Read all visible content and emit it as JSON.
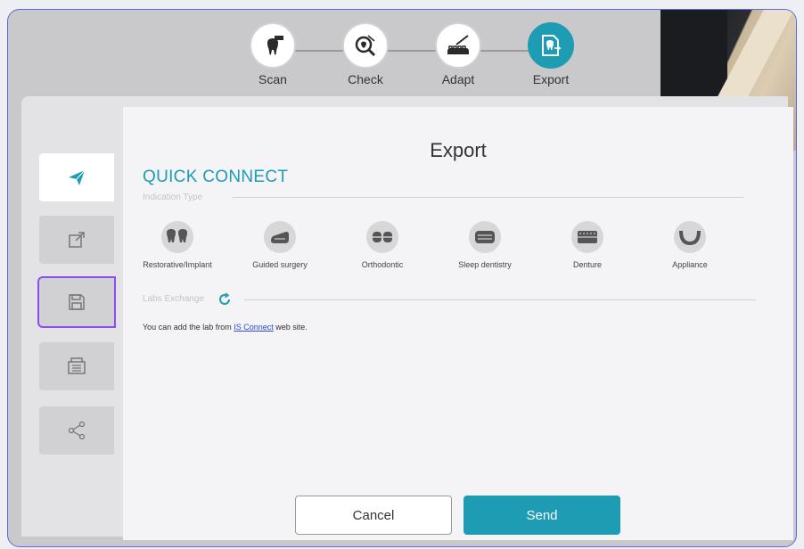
{
  "stepper": {
    "steps": [
      {
        "label": "Scan",
        "icon": "scan-tooth-icon"
      },
      {
        "label": "Check",
        "icon": "check-magnifier-icon"
      },
      {
        "label": "Adapt",
        "icon": "adapt-tool-icon"
      },
      {
        "label": "Export",
        "icon": "export-document-icon"
      }
    ],
    "active_index": 3
  },
  "panel": {
    "title": "Export",
    "quick_connect_title": "QUICK CONNECT",
    "indication_type_label": "Indication Type",
    "indications": [
      {
        "label": "Restorative/Implant",
        "icon": "restorative-implant-icon"
      },
      {
        "label": "Guided surgery",
        "icon": "guided-surgery-icon"
      },
      {
        "label": "Orthodontic",
        "icon": "orthodontic-icon"
      },
      {
        "label": "Sleep dentistry",
        "icon": "sleep-dentistry-icon"
      },
      {
        "label": "Denture",
        "icon": "denture-icon"
      },
      {
        "label": "Appliance",
        "icon": "appliance-icon"
      }
    ],
    "labs_exchange_label": "Labs Exchange",
    "labs_note_prefix": "You can add the lab from ",
    "labs_note_link": "IS Connect",
    "labs_note_suffix": " web site.",
    "cancel_label": "Cancel",
    "send_label": "Send"
  },
  "sidebar": {
    "items": [
      {
        "icon": "send-plane-icon",
        "active": true
      },
      {
        "icon": "external-link-icon"
      },
      {
        "icon": "save-disk-icon",
        "highlighted": true
      },
      {
        "icon": "print-tray-icon"
      },
      {
        "icon": "share-icon"
      }
    ]
  },
  "colors": {
    "accent": "#1e9cb4",
    "highlight_outline": "#8a4ef0",
    "frame_border": "#5b6bd9",
    "link": "#2b4bd8"
  }
}
